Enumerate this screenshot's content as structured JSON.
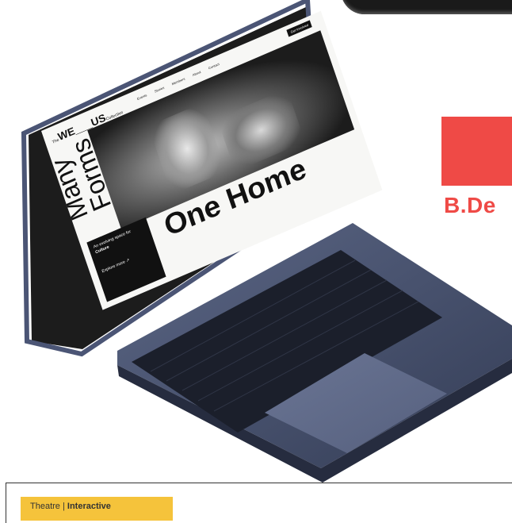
{
  "brand": {
    "text": "B.De",
    "color": "#ef4a46"
  },
  "screen": {
    "logo_prefix": "The",
    "logo_main": "WE___US",
    "logo_suffix": "Collective",
    "nav": [
      "Events",
      "Stories",
      "Members",
      "About",
      "Contact"
    ],
    "nav_cta": "Get Involved",
    "headline_vertical": "Many Forms",
    "headline_main": "One Home",
    "card_text": "An evolving space for",
    "card_bold": "Culture",
    "card_link": "Explore more ↗"
  },
  "bottom_card": {
    "label_prefix": "Theatre | ",
    "label_bold": "Interactive",
    "color": "#f5c33b"
  }
}
